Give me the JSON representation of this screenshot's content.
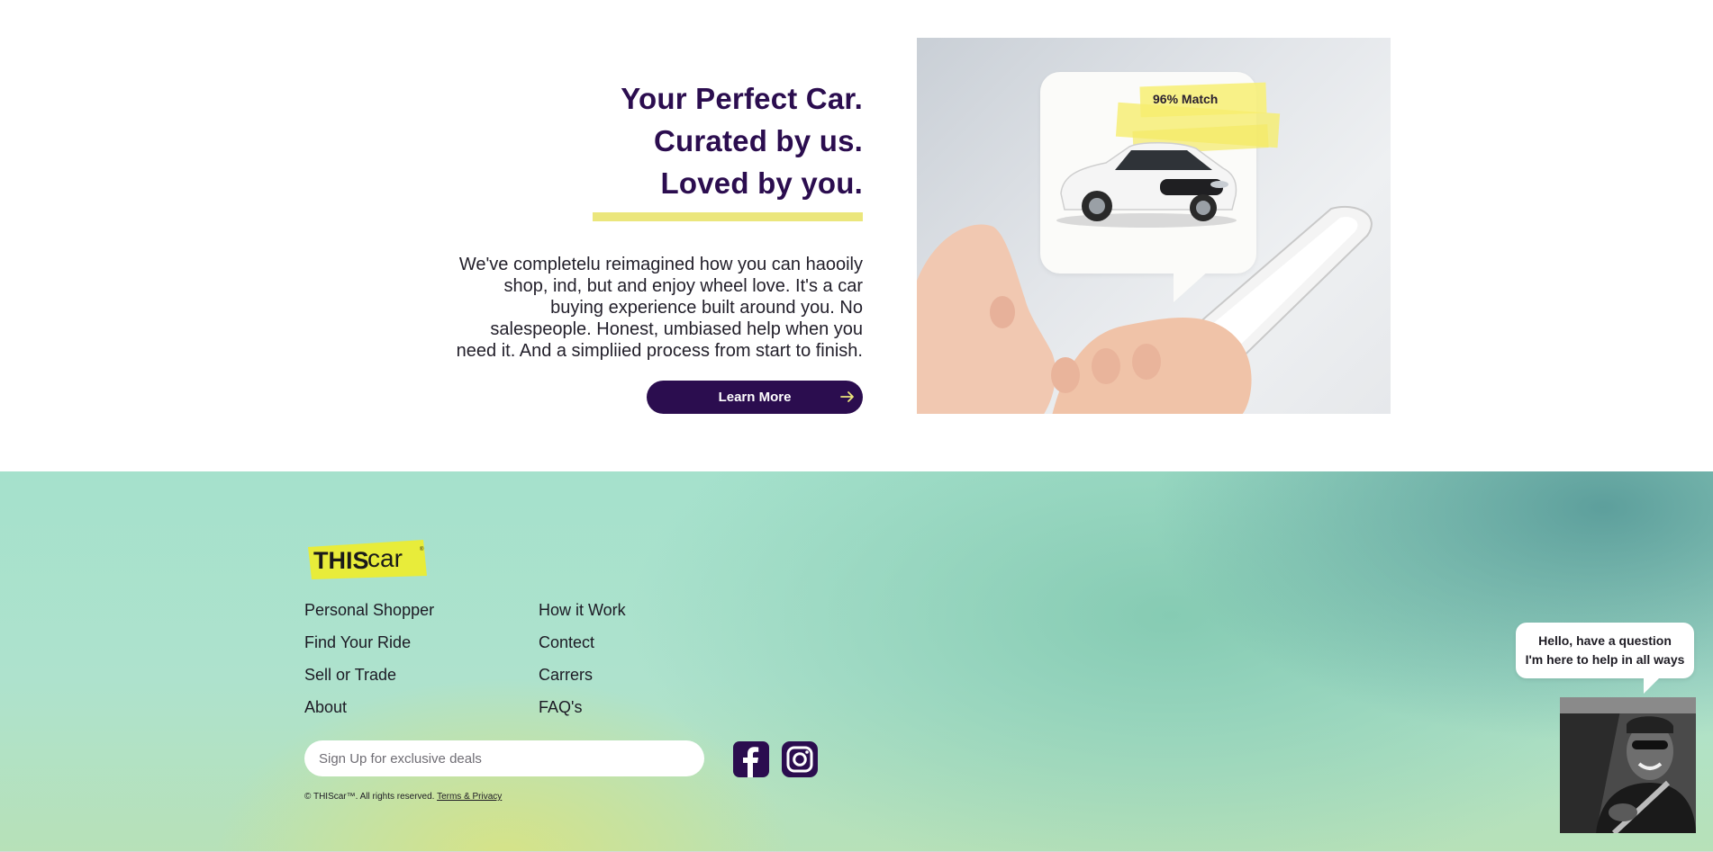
{
  "hero": {
    "headline": [
      "Your Perfect Car.",
      "Curated by us.",
      "Loved by you."
    ],
    "body": "We've completelu reimagined how you can haooily shop, ind, but and enjoy wheel love. It's a car buying experience built around you. No salespeople. Honest, umbiased help when you need it. And a simpliied process from start to finish.",
    "cta_label": "Learn More",
    "match_label": "96% Match"
  },
  "footer": {
    "logo_text_bold": "THIS",
    "logo_text_light": "car",
    "links_col1": [
      "Personal Shopper",
      "Find Your Ride",
      "Sell or Trade",
      "About"
    ],
    "links_col2": [
      "How it Work",
      "Contect",
      "Carrers",
      "FAQ's"
    ],
    "signup_placeholder": "Sign Up for exclusive deals",
    "copyright": "© THIScar™. All rights reserved.",
    "terms_label": "Terms & Privacy"
  },
  "chat": {
    "line1": "Hello, have a question",
    "line2": "I'm here to help in all ways"
  },
  "colors": {
    "brand_purple": "#2b0d4f",
    "accent_yellow": "#ebe67c",
    "logo_yellow": "#e8ec3a"
  }
}
